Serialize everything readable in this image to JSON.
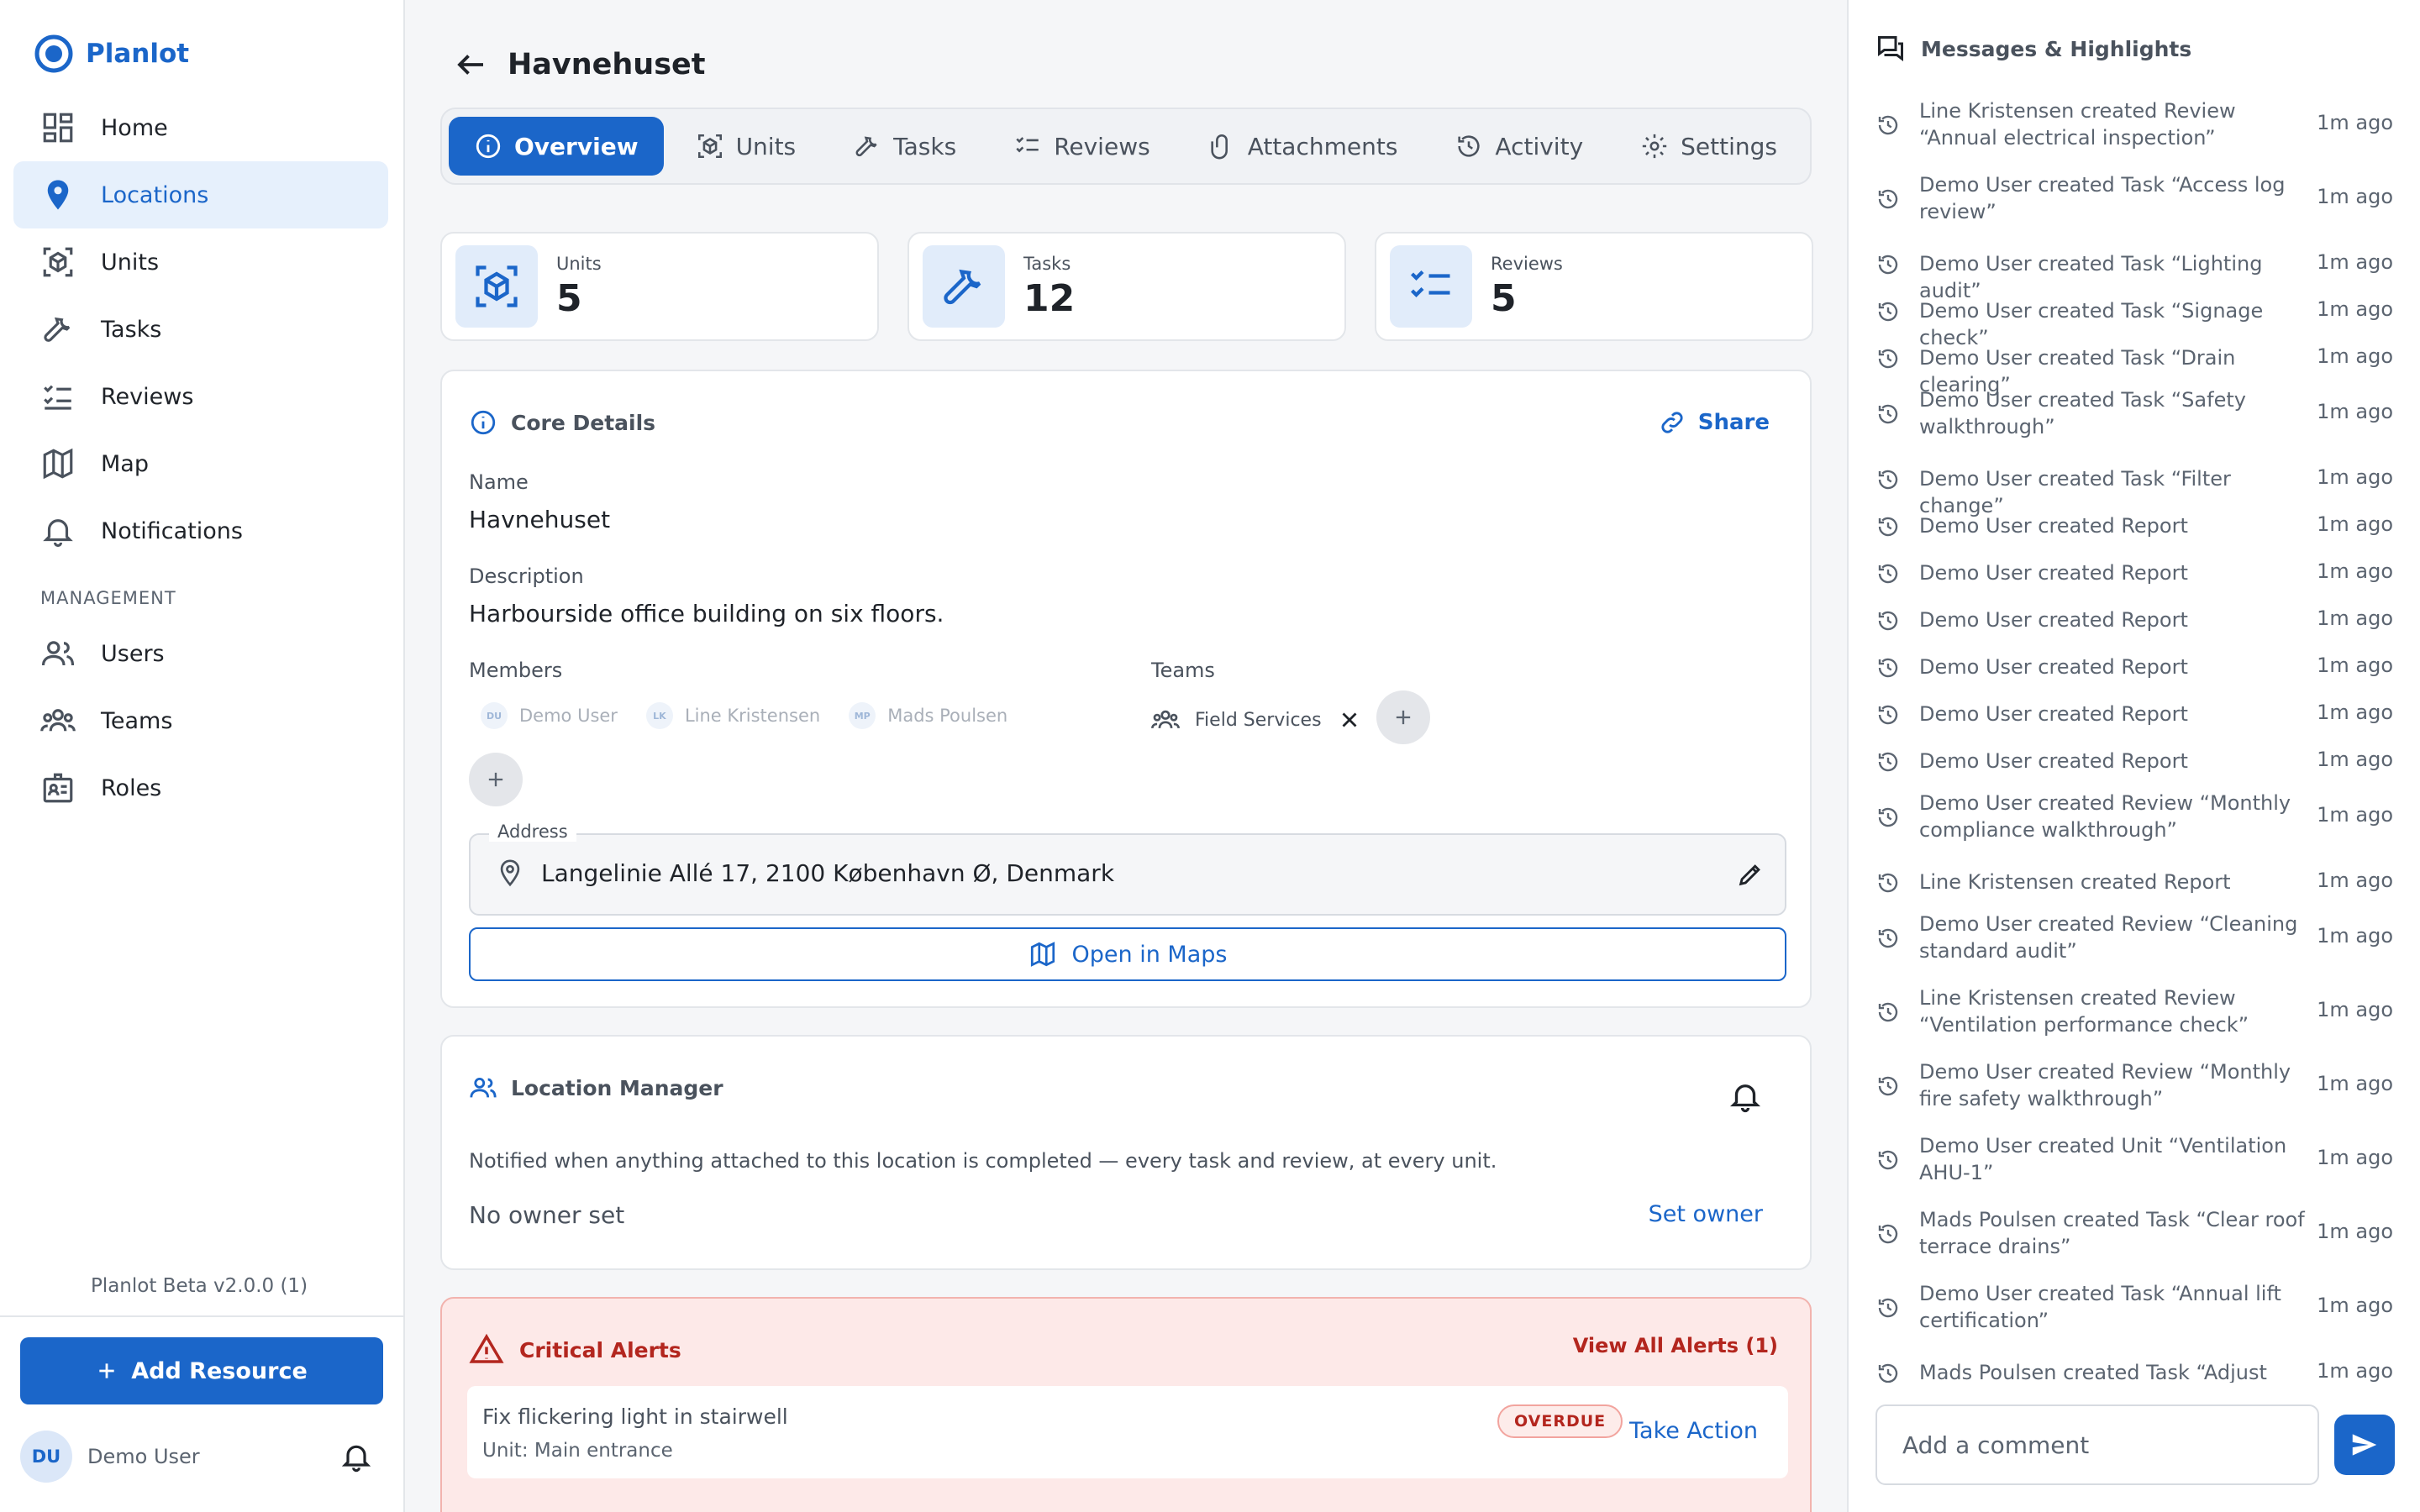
{
  "brand": {
    "name": "Planlot",
    "accent": "#1b66c9"
  },
  "sidebar": {
    "items": [
      {
        "label": "Home",
        "icon": "dashboard-icon"
      },
      {
        "label": "Locations",
        "icon": "location-pin-icon",
        "active": true
      },
      {
        "label": "Units",
        "icon": "cube-scan-icon"
      },
      {
        "label": "Tasks",
        "icon": "wrench-icon"
      },
      {
        "label": "Reviews",
        "icon": "checklist-icon"
      },
      {
        "label": "Map",
        "icon": "map-icon"
      },
      {
        "label": "Notifications",
        "icon": "bell-icon"
      }
    ],
    "section_label": "MANAGEMENT",
    "management_items": [
      {
        "label": "Users",
        "icon": "users-icon"
      },
      {
        "label": "Teams",
        "icon": "teams-icon"
      },
      {
        "label": "Roles",
        "icon": "badge-icon"
      }
    ],
    "version": "Planlot Beta v2.0.0 (1)",
    "add_resource": "Add Resource",
    "user": {
      "initials": "DU",
      "name": "Demo User"
    }
  },
  "page": {
    "title": "Havnehuset",
    "tabs": [
      {
        "label": "Overview",
        "icon": "info-icon",
        "active": true
      },
      {
        "label": "Units",
        "icon": "cube-scan-icon"
      },
      {
        "label": "Tasks",
        "icon": "wrench-icon"
      },
      {
        "label": "Reviews",
        "icon": "checklist-icon"
      },
      {
        "label": "Attachments",
        "icon": "paperclip-icon"
      },
      {
        "label": "Activity",
        "icon": "history-icon"
      },
      {
        "label": "Settings",
        "icon": "gear-icon"
      }
    ],
    "stats": [
      {
        "label": "Units",
        "value": "5",
        "icon": "cube-scan-icon"
      },
      {
        "label": "Tasks",
        "value": "12",
        "icon": "wrench-icon"
      },
      {
        "label": "Reviews",
        "value": "5",
        "icon": "checklist-icon"
      }
    ],
    "core": {
      "title": "Core Details",
      "share": "Share",
      "name_label": "Name",
      "name_value": "Havnehuset",
      "description_label": "Description",
      "description_value": "Harbourside office building on six floors.",
      "members_label": "Members",
      "members": [
        {
          "initials": "DU",
          "name": "Demo User"
        },
        {
          "initials": "LK",
          "name": "Line Kristensen"
        },
        {
          "initials": "MP",
          "name": "Mads Poulsen"
        }
      ],
      "teams_label": "Teams",
      "team": "Field Services",
      "address_label": "Address",
      "address_value": "Langelinie Allé 17, 2100 København Ø, Denmark",
      "open_maps": "Open in Maps"
    },
    "manager": {
      "title": "Location Manager",
      "description": "Notified when anything attached to this location is completed — every task and review, at every unit.",
      "owner": "No owner set",
      "set_owner": "Set owner"
    },
    "alerts": {
      "title": "Critical Alerts",
      "view_all": "View All Alerts (1)",
      "item_title": "Fix flickering light in stairwell",
      "item_unit": "Unit: Main entrance",
      "badge": "OVERDUE",
      "action": "Take Action",
      "color": "#b3261e"
    }
  },
  "panel": {
    "title": "Messages & Highlights",
    "feed": [
      {
        "text": "Line Kristensen created Review “Annual electrical inspection”",
        "time": "1m ago"
      },
      {
        "text": "Demo User created Task “Access log review”",
        "time": "1m ago"
      },
      {
        "text": "Demo User created Task “Lighting audit”",
        "time": "1m ago"
      },
      {
        "text": "Demo User created Task “Signage check”",
        "time": "1m ago"
      },
      {
        "text": "Demo User created Task “Drain clearing”",
        "time": "1m ago"
      },
      {
        "text": "Demo User created Task “Safety walkthrough”",
        "time": "1m ago"
      },
      {
        "text": "Demo User created Task “Filter change”",
        "time": "1m ago"
      },
      {
        "text": "Demo User created Report",
        "time": "1m ago"
      },
      {
        "text": "Demo User created Report",
        "time": "1m ago"
      },
      {
        "text": "Demo User created Report",
        "time": "1m ago"
      },
      {
        "text": "Demo User created Report",
        "time": "1m ago"
      },
      {
        "text": "Demo User created Report",
        "time": "1m ago"
      },
      {
        "text": "Demo User created Report",
        "time": "1m ago"
      },
      {
        "text": "Demo User created Review “Monthly compliance walkthrough”",
        "time": "1m ago"
      },
      {
        "text": "Line Kristensen created Report",
        "time": "1m ago"
      },
      {
        "text": "Demo User created Review “Cleaning standard audit”",
        "time": "1m ago"
      },
      {
        "text": "Line Kristensen created Review “Ventilation performance check”",
        "time": "1m ago"
      },
      {
        "text": "Demo User created Review “Monthly fire safety walkthrough”",
        "time": "1m ago"
      },
      {
        "text": "Demo User created Unit “Ventilation AHU-1”",
        "time": "1m ago"
      },
      {
        "text": "Mads Poulsen created Task “Clear roof terrace drains”",
        "time": "1m ago"
      },
      {
        "text": "Demo User created Task “Annual lift certification”",
        "time": "1m ago"
      },
      {
        "text": "Mads Poulsen created Task “Adjust main",
        "time": "1m ago"
      }
    ],
    "comment_placeholder": "Add a comment"
  }
}
